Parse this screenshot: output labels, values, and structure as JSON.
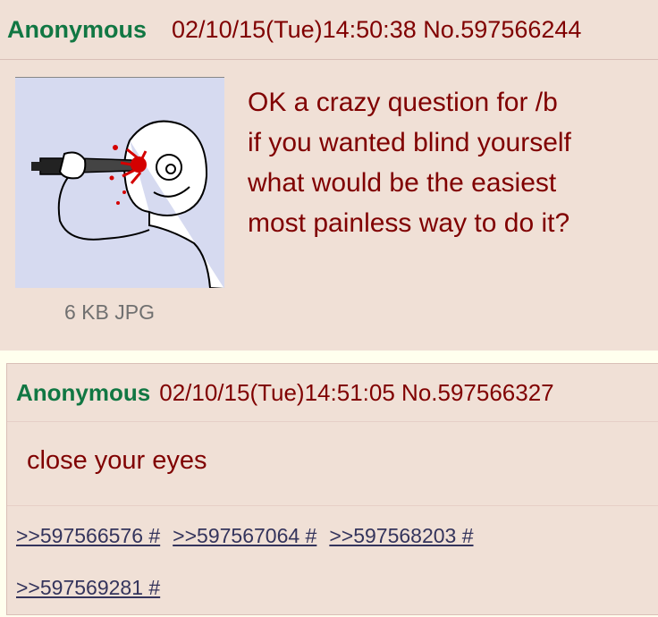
{
  "op": {
    "name": "Anonymous",
    "datetime": "02/10/15(Tue)14:50:38",
    "post_no": "No.597566244",
    "file_info": "6 KB JPG",
    "lines": [
      "OK a crazy question for /b",
      "if you wanted blind yourself",
      "what would be the easiest",
      "most painless way to do it?"
    ]
  },
  "reply": {
    "name": "Anonymous",
    "datetime": "02/10/15(Tue)14:51:05",
    "post_no": "No.597566327",
    "text": "close your eyes",
    "backlinks": [
      ">>597566576 #",
      ">>597567064 #",
      ">>597568203 #",
      ">>597569281 #"
    ]
  },
  "colors": {
    "background": "#ffffee",
    "post_bg": "#f0e0d6",
    "name": "#117743",
    "text": "#800000",
    "link": "#34345c",
    "thumb_bg": "#d6daf0"
  }
}
